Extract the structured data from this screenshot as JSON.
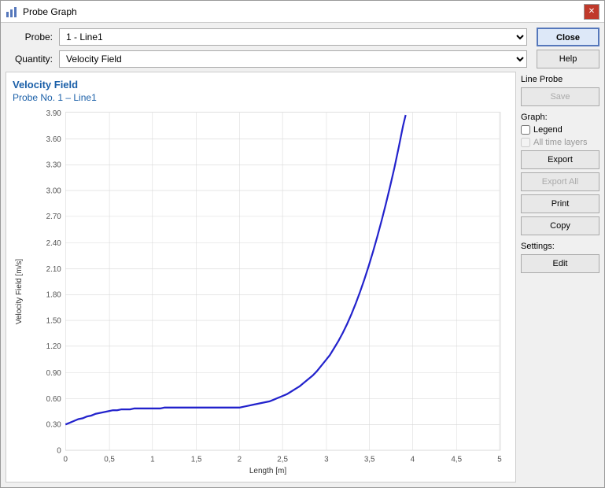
{
  "window": {
    "title": "Probe Graph",
    "icon": "chart-icon"
  },
  "form": {
    "probe_label": "Probe:",
    "probe_value": "1 - Line1",
    "quantity_label": "Quantity:",
    "quantity_value": "Velocity Field",
    "probe_options": [
      "1 - Line1"
    ],
    "quantity_options": [
      "Velocity Field"
    ]
  },
  "chart": {
    "title": "Velocity Field",
    "subtitle": "Probe No. 1 – Line1",
    "y_label": "Velocity Field [m/s]",
    "x_label": "Length [m]",
    "y_ticks": [
      "0",
      "0.30",
      "0.60",
      "0.90",
      "1.20",
      "1.50",
      "1.80",
      "2.10",
      "2.40",
      "2.70",
      "3.00",
      "3.30",
      "3.60",
      "3.90"
    ],
    "x_ticks": [
      "0",
      "0,5",
      "1",
      "1,5",
      "2",
      "2,5",
      "3",
      "3,5",
      "4",
      "4,5",
      "5"
    ]
  },
  "right_panel": {
    "line_probe_label": "Line Probe",
    "save_button": "Save",
    "graph_label": "Graph:",
    "legend_label": "Legend",
    "all_time_layers_label": "All time layers",
    "export_button": "Export",
    "export_all_button": "Export All",
    "print_button": "Print",
    "copy_button": "Copy",
    "settings_label": "Settings:",
    "edit_button": "Edit"
  },
  "header_buttons": {
    "close_label": "Close",
    "help_label": "Help"
  }
}
